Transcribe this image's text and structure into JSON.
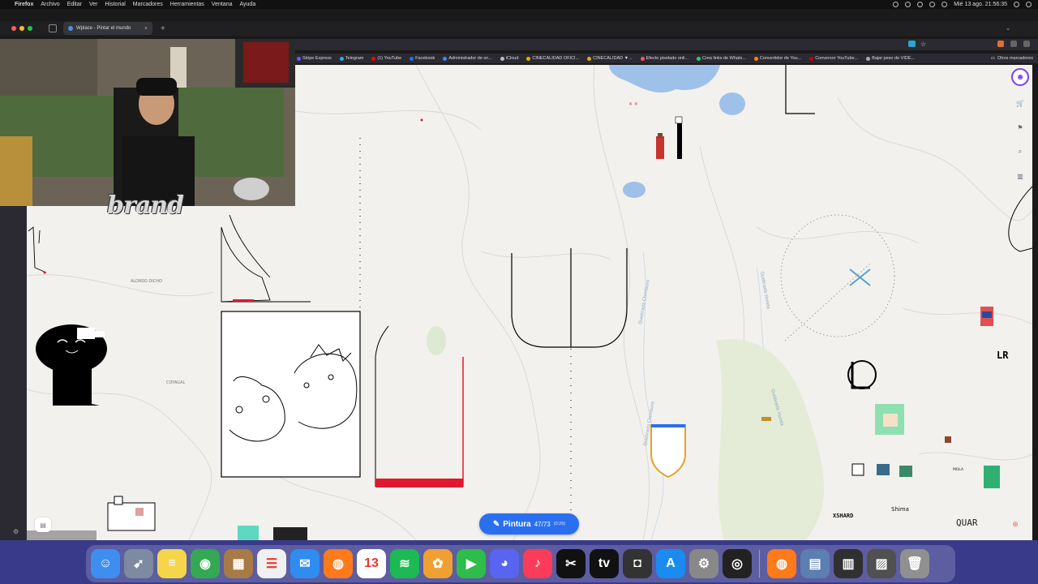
{
  "menubar": {
    "app": "Firefox",
    "items": [
      "Archivo",
      "Editar",
      "Ver",
      "Historial",
      "Marcadores",
      "Herramientas",
      "Ventana",
      "Ayuda"
    ],
    "datetime": "Mié 13 ago.  21:56:35"
  },
  "browser": {
    "tab_title": "Wplace - Pintar el mundo",
    "new_tab": "+",
    "bookmarks": [
      {
        "label": "Stripe Express",
        "color": "#635bff"
      },
      {
        "label": "Telegram",
        "color": "#2aabee"
      },
      {
        "label": "(1) YouTube",
        "color": "#ff0000"
      },
      {
        "label": "Facebook",
        "color": "#1877f2"
      },
      {
        "label": "Administrador de sn...",
        "color": "#4285f4"
      },
      {
        "label": "iCloud",
        "color": "#bbbbbb"
      },
      {
        "label": "CINECALIDAD OFICI...",
        "color": "#e0b000"
      },
      {
        "label": "CINECALIDAD ▼...",
        "color": "#e0b000"
      },
      {
        "label": "Efecto pixelado onli...",
        "color": "#ff5555"
      },
      {
        "label": "Crea links de Whats...",
        "color": "#25d366"
      },
      {
        "label": "Convertidor de You...",
        "color": "#ff8800"
      },
      {
        "label": "Conversor YouTube...",
        "color": "#cc0000"
      },
      {
        "label": "Bajar peso de VIDE...",
        "color": "#aaaaaa"
      }
    ],
    "other_bookmarks": "Otros marcadores"
  },
  "overlay": {
    "brand_text": "brand"
  },
  "map": {
    "labels": [
      {
        "text": "ALONSO DICHO"
      },
      {
        "text": "COYAGAL"
      },
      {
        "text": "Quebrada Chimburo"
      },
      {
        "text": "Quebrada Chimburo"
      },
      {
        "text": "Quebrada Honda"
      },
      {
        "text": "Quebrada Honda"
      }
    ],
    "art_text": {
      "lr": "LR",
      "xshard": "XSHARD",
      "shima": "Shima",
      "quar": "QUAR",
      "mola": "MOLA"
    }
  },
  "paint_button": {
    "label": "Pintura",
    "count": "47/73",
    "timer": "(0:26)",
    "icon": "pencil-icon"
  },
  "dock": {
    "apps": [
      {
        "name": "Finder",
        "color": "#3d8ef0",
        "glyph": "☺"
      },
      {
        "name": "Launchpad",
        "color": "#7d8aa0",
        "glyph": "➹"
      },
      {
        "name": "Notes",
        "color": "#f5d64a",
        "glyph": "≡"
      },
      {
        "name": "Chrome",
        "color": "#34a853",
        "glyph": "◉"
      },
      {
        "name": "Archive",
        "color": "#a87a45",
        "glyph": "▦"
      },
      {
        "name": "Reminders",
        "color": "#f0f0f0",
        "glyph": "☰"
      },
      {
        "name": "Messages",
        "color": "#2f8cf0",
        "glyph": "✉"
      },
      {
        "name": "Firefox",
        "color": "#ff7a1a",
        "glyph": "◍"
      },
      {
        "name": "Calendar",
        "color": "#ffffff",
        "glyph": "13"
      },
      {
        "name": "Spotify",
        "color": "#1db954",
        "glyph": "≋"
      },
      {
        "name": "Photos",
        "color": "#f0a030",
        "glyph": "✿"
      },
      {
        "name": "FaceTime",
        "color": "#2ebd4a",
        "glyph": "▶"
      },
      {
        "name": "Discord",
        "color": "#5865f2",
        "glyph": "◕"
      },
      {
        "name": "Music",
        "color": "#fa3c5a",
        "glyph": "♪"
      },
      {
        "name": "CapCut",
        "color": "#111111",
        "glyph": "✂"
      },
      {
        "name": "Apple TV",
        "color": "#111111",
        "glyph": "tv"
      },
      {
        "name": "Camera",
        "color": "#333333",
        "glyph": "◘"
      },
      {
        "name": "App Store",
        "color": "#1a8cf0",
        "glyph": "A"
      },
      {
        "name": "System Settings",
        "color": "#888888",
        "glyph": "⚙"
      },
      {
        "name": "OBS",
        "color": "#222222",
        "glyph": "◎"
      }
    ],
    "recent": [
      {
        "name": "Firefox",
        "color": "#ff7a1a",
        "glyph": "◍"
      },
      {
        "name": "Preview",
        "color": "#5a7fb0",
        "glyph": "▤"
      },
      {
        "name": "Folder",
        "color": "#303030",
        "glyph": "▥"
      },
      {
        "name": "Folder 2",
        "color": "#505050",
        "glyph": "▨"
      },
      {
        "name": "Trash",
        "color": "#909090",
        "glyph": "🗑"
      }
    ]
  }
}
